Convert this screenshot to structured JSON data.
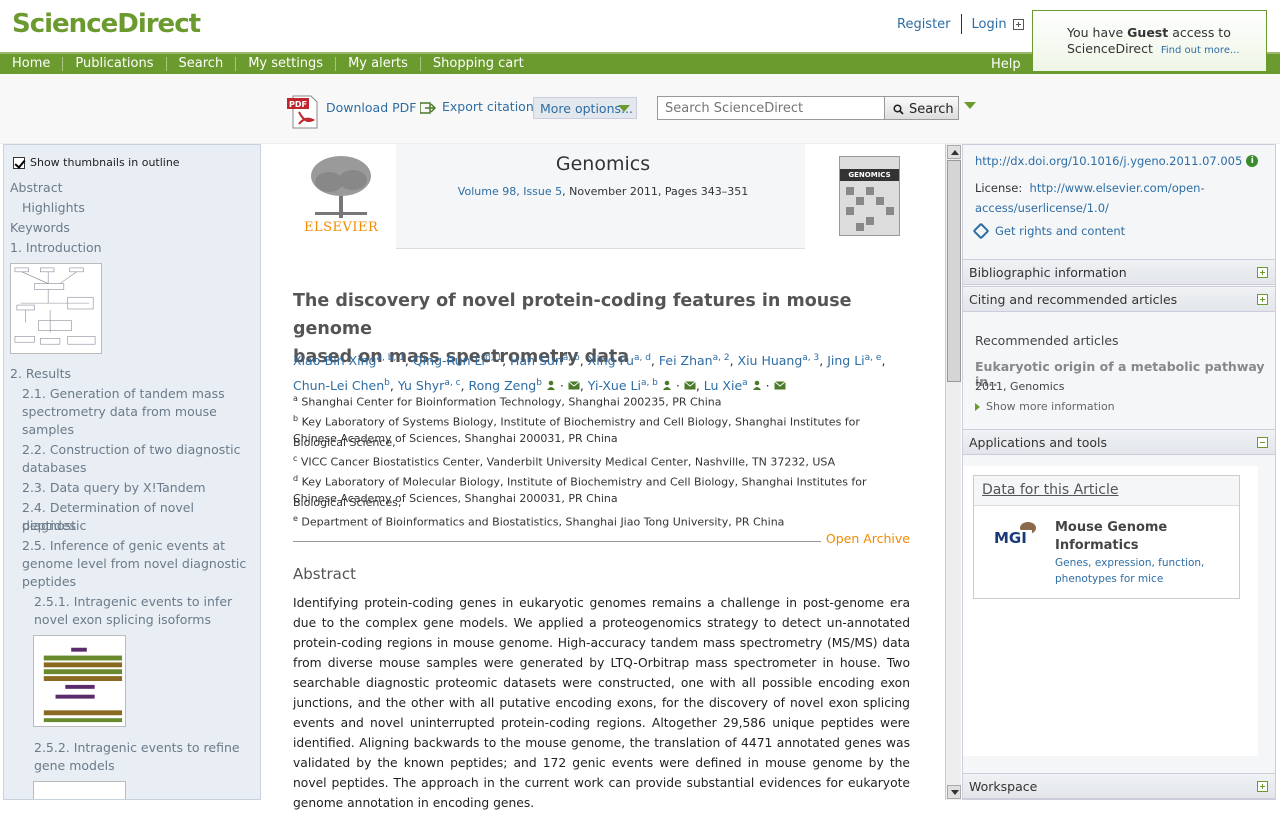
{
  "header": {
    "logo": "ScienceDirect",
    "register": "Register",
    "login": "Login",
    "guest_pre": "You have ",
    "guest_bold": "Guest",
    "guest_post": " access to",
    "guest_line2": "ScienceDirect",
    "guest_find": "Find out more..."
  },
  "nav": {
    "items": [
      "Home",
      "Publications",
      "Search",
      "My settings",
      "My alerts",
      "Shopping cart"
    ],
    "help": "Help"
  },
  "toolbar": {
    "pdf_label": "PDF",
    "download_pdf": "Download PDF",
    "export_citation": "Export citation",
    "more_options": "More options...",
    "search_placeholder": "Search ScienceDirect",
    "search_button": "Search"
  },
  "outline": {
    "show_thumbnails": "Show thumbnails in outline",
    "items": [
      "Abstract",
      "Highlights",
      "Keywords",
      "1. Introduction",
      "2. Results",
      "2.1. Generation of tandem mass",
      "spectrometry data from mouse",
      "samples",
      "2.2. Construction of two diagnostic",
      "databases",
      "2.3. Data query by X!Tandem",
      "2.4. Determination of novel diagnostic",
      "peptides",
      "2.5. Inference of genic events at",
      "genome level from novel diagnostic",
      "peptides",
      "2.5.1. Intragenic events to infer",
      "novel exon splicing isoforms",
      "2.5.2. Intragenic events to refine",
      "gene models"
    ]
  },
  "journal": {
    "publisher": "ELSEVIER",
    "name": "Genomics",
    "volume_link": "Volume 98, Issue 5",
    "volume_rest": ", November 2011, Pages 343–351",
    "cover_label": "GENOMICS"
  },
  "article": {
    "title_line1": "The discovery of novel protein-coding features in mouse genome",
    "title_line2": "based on mass spectrometry data",
    "authors": [
      {
        "name": "Xiao-Bin Xing",
        "sup": "a, b, 1"
      },
      {
        "name": "Qing-Run Li",
        "sup": "b, 1"
      },
      {
        "name": "Han Sun",
        "sup": "a, b"
      },
      {
        "name": "Xing Fu",
        "sup": "a, d"
      },
      {
        "name": "Fei Zhan",
        "sup": "a, 2"
      },
      {
        "name": "Xiu Huang",
        "sup": "a, 3"
      },
      {
        "name": "Jing Li",
        "sup": "a, e"
      },
      {
        "name": "Chun-Lei Chen",
        "sup": "b"
      },
      {
        "name": "Yu Shyr",
        "sup": "a, c"
      },
      {
        "name": "Rong Zeng",
        "sup": "b"
      },
      {
        "name": "Yi-Xue Li",
        "sup": "a, b"
      },
      {
        "name": "Lu Xie",
        "sup": "a"
      }
    ],
    "affiliations": [
      {
        "sup": "a",
        "text": "Shanghai Center for Bioinformation Technology, Shanghai 200235, PR China"
      },
      {
        "sup": "b",
        "text": "Key Laboratory of Systems Biology, Institute of Biochemistry and Cell Biology, Shanghai Institutes for Biological Science,"
      },
      {
        "sup": "",
        "text": "Chinese Academy of Sciences, Shanghai 200031, PR China"
      },
      {
        "sup": "c",
        "text": "VICC Cancer Biostatistics Center, Vanderbilt University Medical Center, Nashville, TN 37232, USA"
      },
      {
        "sup": "d",
        "text": "Key Laboratory of Molecular Biology, Institute of Biochemistry and Cell Biology, Shanghai Institutes for Biological Sciences,"
      },
      {
        "sup": "",
        "text": "Chinese Academy of Sciences, Shanghai 200031, PR China"
      },
      {
        "sup": "e",
        "text": "Department of Bioinformatics and Biostatistics, Shanghai Jiao Tong University, PR China"
      }
    ],
    "open_archive": "Open Archive",
    "abstract_heading": "Abstract",
    "abstract_text": "Identifying protein-coding genes in eukaryotic genomes remains a challenge in post-genome era due to the complex gene models. We applied a proteogenomics strategy to detect un-annotated protein-coding regions in mouse genome. High-accuracy tandem mass spectrometry (MS/MS) data from diverse mouse samples were generated by LTQ-Orbitrap mass spectrometer in house. Two searchable diagnostic proteomic datasets were constructed, one with all possible encoding exon junctions, and the other with all putative encoding exons, for the discovery of novel exon splicing events and novel uninterrupted protein-coding regions. Altogether 29,586 unique peptides were identified. Aligning backwards to the mouse genome, the translation of 4471 annotated genes was validated by the known peptides; and 172 genic events were defined in mouse genome by the novel peptides. The approach in the current work can provide substantial evidences for eukaryote genome annotation in encoding genes."
  },
  "rpanel": {
    "doi": "http://dx.doi.org/10.1016/j.ygeno.2011.07.005",
    "license_label": "License:",
    "license_link1": "http://www.elsevier.com/open-",
    "license_link2": "access/userlicense/1.0/",
    "rights": "Get rights and content",
    "bib_info": "Bibliographic information",
    "citing": "Citing and recommended articles",
    "recommended_head": "Recommended articles",
    "rec_title": "Eukaryotic origin of a metabolic pathway in..",
    "rec_meta": "2011, Genomics",
    "show_more": "Show more information",
    "apps": "Applications and tools",
    "data_head": "Data for this Article",
    "mgi_logo": "MGI",
    "mgi_title1": "Mouse Genome",
    "mgi_title2": "Informatics",
    "mgi_desc1": "Genes, expression, function,",
    "mgi_desc2": "phenotypes for mice",
    "workspace": "Workspace"
  }
}
